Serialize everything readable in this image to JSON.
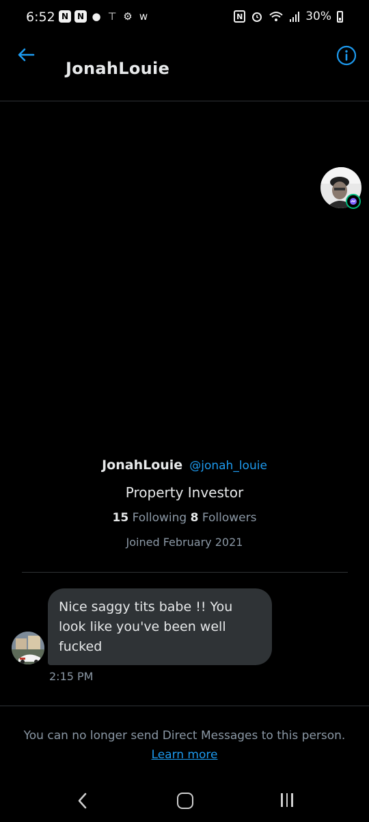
{
  "status_bar": {
    "time": "6:52",
    "battery": "30%",
    "left_icons": [
      "notification-icon",
      "notification-icon",
      "bunny-icon",
      "pin-icon",
      "bear-icon",
      "w-icon"
    ],
    "right_icons": [
      "nfc-icon",
      "alarm-icon",
      "wifi-icon",
      "signal-icon",
      "battery-icon"
    ]
  },
  "header": {
    "title": "JonahLouie",
    "back_icon": "arrow-left-icon",
    "info_icon": "info-icon"
  },
  "profile": {
    "name": "JonahLouie",
    "handle": "@jonah_louie",
    "bio": "Property Investor",
    "following_count": "15",
    "following_label": "Following",
    "followers_count": "8",
    "followers_label": "Followers",
    "joined": "Joined February 2021"
  },
  "message": {
    "text": "Nice saggy tits babe !! You look like you've been well fucked",
    "time": "2:15 PM"
  },
  "notice": {
    "text": "You can no longer send Direct Messages to this person.",
    "link": "Learn more"
  },
  "colors": {
    "accent": "#1d9bf0",
    "background": "#000000",
    "bubble": "#2f3336",
    "muted": "#8b98a5"
  }
}
